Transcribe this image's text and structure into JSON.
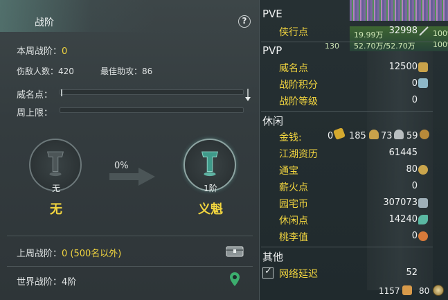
{
  "left": {
    "tab_title": "战阶",
    "help": "?",
    "week_rank_label": "本周战阶：",
    "week_rank_value": "0",
    "kills_label": "伤敌人数：420",
    "assist_label": "最佳助攻：86",
    "fame_label": "威名点：",
    "week_cap_label": "周上限：",
    "progress_pct": "0%",
    "current": {
      "rank": "无",
      "name": "无"
    },
    "next": {
      "rank": "1阶",
      "name": "义魁"
    },
    "last_week_label": "上周战阶：",
    "last_week_value": "0 (500名以外)",
    "world_rank_label": "世界战阶：4阶"
  },
  "right": {
    "bg_overlay": {
      "line1": "19.99万",
      "line2": "130",
      "line3": "52.70万/52.70万",
      "pct1": "100%",
      "pct2": "100%"
    },
    "pve": {
      "title": "PVE",
      "items": [
        {
          "label": "侠行点",
          "value": "32998",
          "icon": "sword-icon"
        }
      ]
    },
    "pvp": {
      "title": "PVP",
      "items": [
        {
          "label": "威名点",
          "value": "12500",
          "icon": "fame-icon"
        },
        {
          "label": "战阶积分",
          "value": "0",
          "icon": "rank-score-icon"
        },
        {
          "label": "战阶等级",
          "value": "0"
        }
      ]
    },
    "leisure": {
      "title": "休闲",
      "money_label": "金钱:",
      "money": {
        "gold": "0",
        "silver_big": "185",
        "silver": "73",
        "copper": "59"
      },
      "items": [
        {
          "label": "江湖资历",
          "value": "61445"
        },
        {
          "label": "通宝",
          "value": "80",
          "icon": "coin-icon"
        },
        {
          "label": "薪火点",
          "value": "0"
        },
        {
          "label": "园宅币",
          "value": "307073",
          "icon": "house-coin-icon"
        },
        {
          "label": "休闲点",
          "value": "14240",
          "icon": "leaf-icon"
        },
        {
          "label": "桃李值",
          "value": "0",
          "icon": "peach-icon"
        }
      ]
    },
    "other": {
      "title": "其他",
      "latency_label": "网络延迟",
      "latency_value": "52"
    },
    "footer": {
      "count1": "1157",
      "count2": "80"
    }
  },
  "colors": {
    "accent_yellow": "#f2d53f",
    "panel_bg": "#343c3f",
    "text": "#dfe3e3"
  }
}
